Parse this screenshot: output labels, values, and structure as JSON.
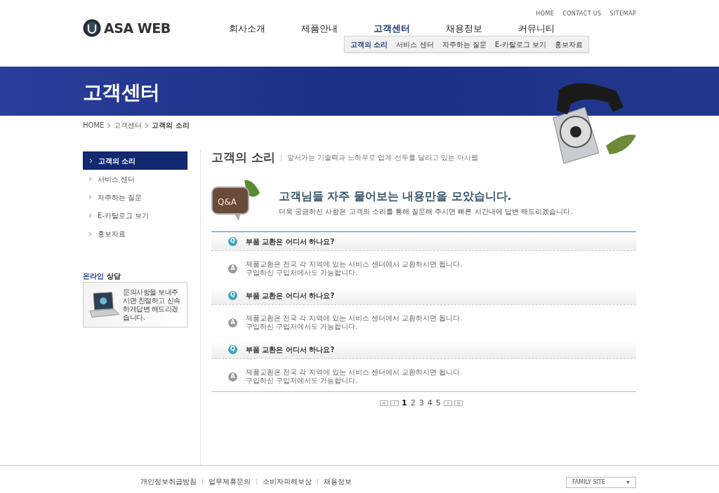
{
  "logo": {
    "text": "ASA WEB"
  },
  "util_links": [
    "HOME",
    "CONTACT US",
    "SITEMAP"
  ],
  "nav": [
    {
      "label": "회사소개",
      "selected": false
    },
    {
      "label": "제품안내",
      "selected": false
    },
    {
      "label": "고객센터",
      "selected": true
    },
    {
      "label": "채용정보",
      "selected": false
    },
    {
      "label": "커뮤니티",
      "selected": false
    }
  ],
  "subnav": [
    {
      "label": "고객의 소리",
      "selected": true
    },
    {
      "label": "서비스 센터",
      "selected": false
    },
    {
      "label": "자주하는 질문",
      "selected": false
    },
    {
      "label": "E-카탈로그 보기",
      "selected": false
    },
    {
      "label": "홍보자료",
      "selected": false
    }
  ],
  "banner": {
    "title": "고객센터"
  },
  "breadcrumb": [
    "HOME",
    "고객센터",
    "고객의 소리"
  ],
  "sidebar": {
    "items": [
      {
        "label": "고객의 소리",
        "selected": true
      },
      {
        "label": "서비스 센터",
        "selected": false
      },
      {
        "label": "자주하는 질문",
        "selected": false
      },
      {
        "label": "E-카탈로그 보기",
        "selected": false
      },
      {
        "label": "홍보자료",
        "selected": false
      }
    ],
    "online": {
      "title_highlight": "온라인",
      "title_rest": "상담",
      "text": "문의사항을 보내주시면 친절하고 신속하게답변 해드리겠습니다."
    }
  },
  "page": {
    "title": "고객의 소리",
    "subtitle": "앞서가는 기술력과 노하우로 업계 선두를 달리고 있는 아사웹",
    "qa_sign": "Q&A",
    "headline": "고객님들 자주 물어보는 내용만을 모았습니다.",
    "description": "더욱 궁금하신 사항은 고객의 소리를 통해 질문해 주시면 빠른 시간내에 답변 해드리겠습니다."
  },
  "faq": [
    {
      "q_icon": "Q",
      "question": "부품 교환은 어디서 하나요?",
      "a_icon": "A",
      "answer": [
        "제품교환은 전국 각 지역에 있는 서비스 센터에서 교환하시면 됩니다.",
        "구입하신 구입처에서도 가능합니다."
      ]
    },
    {
      "q_icon": "Q",
      "question": "부품 교환은 어디서 하나요?",
      "a_icon": "A",
      "answer": [
        "제품교환은 전국 각 지역에 있는 서비스 센터에서 교환하시면 됩니다.",
        "구입하신 구입처에서도 가능합니다."
      ]
    },
    {
      "q_icon": "Q",
      "question": "부품 교환은 어디서 하나요?",
      "a_icon": "A",
      "answer": [
        "제품교환은 전국 각 지역에 있는 서비스 센터에서 교환하시면 됩니다.",
        "구입하신 구입처에서도 가능합니다."
      ]
    }
  ],
  "pagination": [
    {
      "label": "1",
      "selected": true
    },
    {
      "label": "2",
      "selected": false
    },
    {
      "label": "3",
      "selected": false
    },
    {
      "label": "4",
      "selected": false
    },
    {
      "label": "5",
      "selected": false
    }
  ],
  "footer": {
    "links": [
      "개인정보취급방침",
      "업무제휴문의",
      "소비자피해보상",
      "채용정보"
    ],
    "family_site": "FAMILY SITE"
  }
}
